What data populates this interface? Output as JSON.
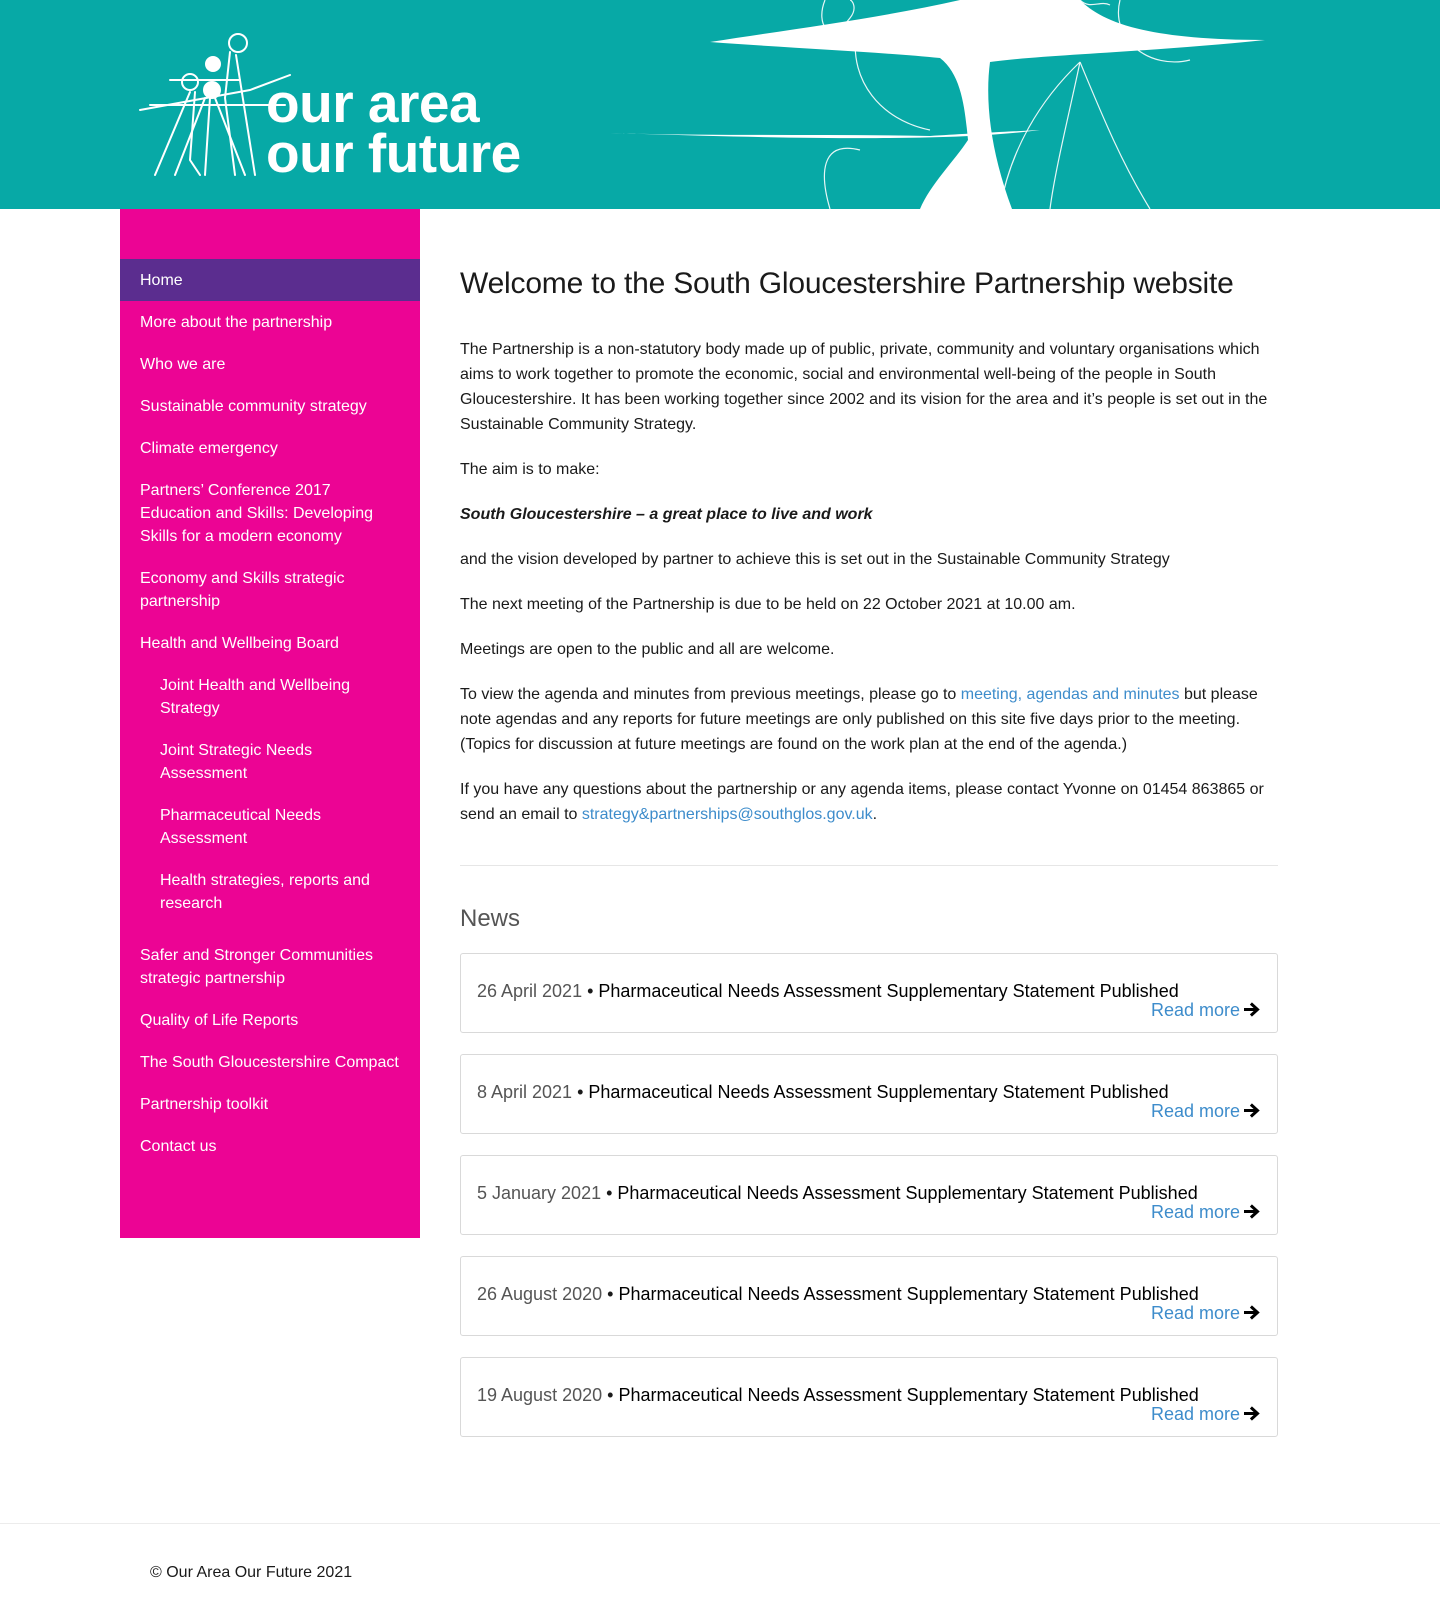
{
  "header": {
    "logo_line1": "our area",
    "logo_line2": "our future"
  },
  "sidebar": {
    "items": [
      {
        "label": "Home",
        "active": true
      },
      {
        "label": "More about the partnership"
      },
      {
        "label": "Who we are"
      },
      {
        "label": "Sustainable community strategy"
      },
      {
        "label": "Climate emergency"
      },
      {
        "label": "Partners’ Conference 2017 Education and Skills: Developing Skills for a modern economy"
      },
      {
        "label": "Economy and Skills strategic partnership"
      },
      {
        "label": "Health and Wellbeing Board"
      },
      {
        "label": "Joint Health and Wellbeing Strategy"
      },
      {
        "label": "Joint Strategic Needs Assessment"
      },
      {
        "label": "Pharmaceutical Needs Assessment"
      },
      {
        "label": "Health strategies, reports and research"
      },
      {
        "label": "Safer and Stronger Communities strategic partnership"
      },
      {
        "label": "Quality of Life Reports"
      },
      {
        "label": "The South Gloucestershire Compact"
      },
      {
        "label": "Partnership toolkit"
      },
      {
        "label": "Contact us"
      }
    ]
  },
  "main": {
    "title": "Welcome to the South Gloucestershire Partnership website",
    "p1": "The Partnership is a non-statutory body made up of public, private, community and voluntary organisations which aims to work together to promote the economic, social and environmental well-being of the people in South Gloucestershire.  It has been working together since 2002 and its vision for the area and it’s people is set out in the Sustainable Community Strategy.",
    "p2": "The aim is to make:",
    "p3": "South Gloucestershire – a great place to live and work",
    "p4": "and the vision developed by partner to achieve this is set out in the Sustainable Community Strategy",
    "p5": "The next meeting of the Partnership is due to be held on 22 October 2021 at 10.00 am.",
    "p6": "Meetings are open to the public and all are welcome.",
    "p7_before": "To view the agenda and minutes from previous meetings, please go to ",
    "p7_link": "meeting, agendas and minutes",
    "p7_after": " but please note agendas and any reports for future meetings are only published on this site five days prior to the meeting. (Topics for discussion at future meetings are found on the work plan at the end of the agenda.)",
    "p8_before": "If you have any questions about the partnership or any agenda items, please contact Yvonne on 01454 863865 or send an email to ",
    "p8_link": "strategy&partnerships@southglos.gov.uk",
    "p8_after": "."
  },
  "news": {
    "title": "News",
    "separator": " • ",
    "read_more": "Read more",
    "items": [
      {
        "date": "26 April 2021",
        "headline": "Pharmaceutical Needs Assessment Supplementary Statement Published"
      },
      {
        "date": "8 April 2021",
        "headline": "Pharmaceutical Needs Assessment Supplementary Statement Published"
      },
      {
        "date": "5 January 2021",
        "headline": "Pharmaceutical Needs Assessment Supplementary Statement Published"
      },
      {
        "date": "26 August 2020",
        "headline": "Pharmaceutical Needs Assessment Supplementary Statement Published"
      },
      {
        "date": "19 August 2020",
        "headline": "Pharmaceutical Needs Assessment Supplementary Statement Published"
      }
    ]
  },
  "footer": {
    "copyright": "© Our Area Our Future 2021"
  },
  "colors": {
    "header_teal": "#07a9a6",
    "sidebar_pink": "#ec0494",
    "active_purple": "#5b2d8f",
    "link_blue": "#3d8ccb"
  },
  "icons": [
    "logo-figures-icon",
    "arrow-right-icon"
  ]
}
